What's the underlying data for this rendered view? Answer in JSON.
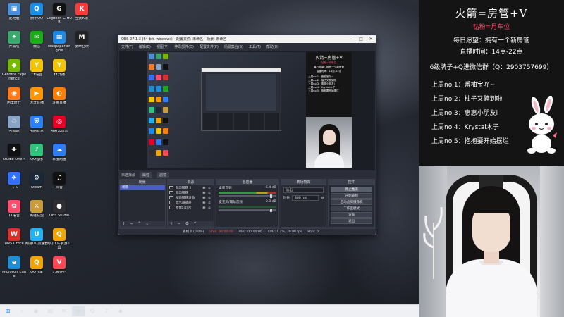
{
  "desktop": {
    "icons": [
      {
        "label": "此电脑",
        "glyph": "▣",
        "color": "#4a90d9"
      },
      {
        "label": "开黑啦",
        "glyph": "✦",
        "color": "#3aa76d"
      },
      {
        "label": "GeForce Experience",
        "glyph": "◆",
        "color": "#76b900"
      },
      {
        "label": "阿里旺旺",
        "glyph": "◉",
        "color": "#ff7a1a"
      },
      {
        "label": "回收站",
        "glyph": "♲",
        "color": "#8aa4c8"
      },
      {
        "label": "Studio One 4",
        "glyph": "✚",
        "color": "#111111"
      },
      {
        "label": "飞书",
        "glyph": "✈",
        "color": "#3370ff"
      },
      {
        "label": "TT语音",
        "glyph": "✿",
        "color": "#ff4d6d"
      },
      {
        "label": "WPS Office",
        "glyph": "W",
        "color": "#d9302c"
      },
      {
        "label": "Microsoft Edge",
        "glyph": "e",
        "color": "#1f8ed6"
      },
      {
        "label": "腾讯QQ",
        "glyph": "Q",
        "color": "#1b8fe6"
      },
      {
        "label": "微信",
        "glyph": "✉",
        "color": "#1aad19"
      },
      {
        "label": "YY语音",
        "glyph": "Y",
        "color": "#f5c400"
      },
      {
        "label": "虎牙直播",
        "glyph": "▶",
        "color": "#ff9600"
      },
      {
        "label": "电脑管家",
        "glyph": "⛨",
        "color": "#2d7ff9"
      },
      {
        "label": "QQ音乐",
        "glyph": "♪",
        "color": "#31c27c"
      },
      {
        "label": "Steam",
        "glyph": "⚙",
        "color": "#1b2838"
      },
      {
        "label": "英雄联盟",
        "glyph": "⚔",
        "color": "#c89b3c"
      },
      {
        "label": "网易UU加速器",
        "glyph": "U",
        "color": "#22b2f2"
      },
      {
        "label": "QQ飞车",
        "glyph": "Q",
        "color": "#f0a500"
      },
      {
        "label": "Logitech G HUB",
        "glyph": "G",
        "color": "#111111"
      },
      {
        "label": "Wallpaper Engine",
        "glyph": "▦",
        "color": "#1e88e5"
      },
      {
        "label": "YY开播",
        "glyph": "Y",
        "color": "#f5c400"
      },
      {
        "label": "斗鱼直播",
        "glyph": "◐",
        "color": "#ff7d00"
      },
      {
        "label": "网易云音乐",
        "glyph": "◎",
        "color": "#e60026"
      },
      {
        "label": "百度网盘",
        "glyph": "☁",
        "color": "#2e7cf6"
      },
      {
        "label": "抖音",
        "glyph": "♫",
        "color": "#111111"
      },
      {
        "label": "OBS Studio",
        "glyph": "●",
        "color": "#302e31"
      },
      {
        "label": "QQ飞车手游工具",
        "glyph": "Q",
        "color": "#f0a500"
      },
      {
        "label": "无畏契约",
        "glyph": "V",
        "color": "#ff4655"
      },
      {
        "label": "全民K歌",
        "glyph": "K",
        "color": "#ff3a3a"
      },
      {
        "label": "使命召唤",
        "glyph": "M",
        "color": "#222222"
      }
    ]
  },
  "taskbar": {
    "items": [
      {
        "name": "start",
        "glyph": "⊞"
      },
      {
        "name": "search",
        "glyph": "⌕"
      },
      {
        "name": "chrome",
        "glyph": "◉"
      },
      {
        "name": "explorer",
        "glyph": "▤"
      },
      {
        "name": "wechat",
        "glyph": "✉"
      },
      {
        "name": "obs",
        "glyph": "●"
      },
      {
        "name": "qq",
        "glyph": "Q"
      },
      {
        "name": "music",
        "glyph": "♪"
      },
      {
        "name": "game",
        "glyph": "◆"
      }
    ]
  },
  "obs": {
    "title": "OBS 27.1.3 (64-bit, windows) - 配置文件: 未命名 - 场景: 未命名",
    "menu": [
      "文件(F)",
      "编辑(E)",
      "视图(V)",
      "停靠部件(D)",
      "配置文件(P)",
      "场景集合(S)",
      "工具(T)",
      "帮助(H)"
    ],
    "scenebar": {
      "label": "未选择源",
      "props": "属性",
      "filters": "滤镜"
    },
    "docks": {
      "scenes": {
        "title": "场景",
        "items": [
          "场景"
        ]
      },
      "sources": {
        "title": "来源",
        "items": [
          "窗口捕获 2",
          "窗口捕获",
          "视频捕获设备",
          "显示器捕获",
          "图像幻灯片"
        ]
      },
      "mixer": {
        "title": "混音器",
        "rows": [
          {
            "name": "桌面音频",
            "db": "-6.4 dB"
          },
          {
            "name": "麦克风/辅助音频",
            "db": "0.0 dB"
          }
        ]
      },
      "transitions": {
        "title": "转场特效",
        "selected": "淡出",
        "duration_label": "时长",
        "duration": "300 ms"
      },
      "controls": {
        "title": "控件",
        "buttons": [
          "停止推流",
          "开始录制",
          "启动虚拟摄像机",
          "工作室模式",
          "设置",
          "退出"
        ]
      }
    },
    "status": {
      "live": "LIVE: 00:00:00",
      "rec": "REC: 00:00:00",
      "cpu": "CPU: 1.2%, 30.00 fps",
      "drop": "丢帧 0 (0.0%)",
      "kbps": "kb/s: 0"
    }
  },
  "overlay": {
    "title": "火箭=房管+V",
    "subtitle": "钻粉=月车位",
    "wish": "每日愿望：拥有一个新房管",
    "hours": "直播时间：14点-22点",
    "group": "6级牌子+Q进微信群（Q：2903757699）",
    "ranks": [
      "上周no.1：番柚宝吖~",
      "上周no.2：柚子又醉到啦",
      "上周no.3：惠惠小朋友i",
      "上周no.4：Krystal木子",
      "上周no.5：抱抱要开始摆烂"
    ]
  },
  "preview": {
    "title": "火箭=房管+V",
    "subtitle": "钻粉=月车位",
    "wish": "每日愿望：拥有一个新房管",
    "hours": "直播时间：14点-22点"
  }
}
